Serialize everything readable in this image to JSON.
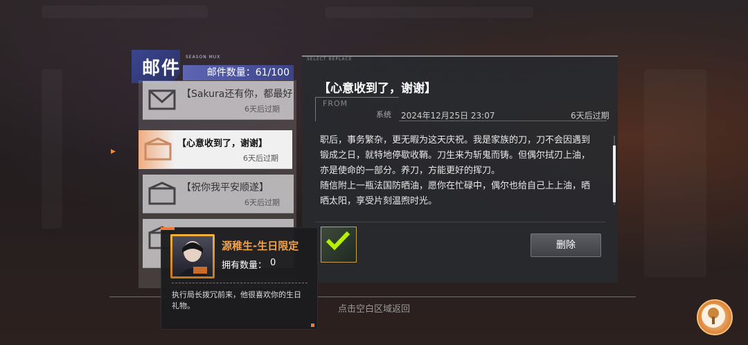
{
  "mail_panel": {
    "title": "邮件",
    "subtitle": "SEASON MUX",
    "count_label": "邮件数量：61/100"
  },
  "mail_list": [
    {
      "title": "【Sakura还有你，都最好",
      "expire": "6天后过期",
      "selected": false
    },
    {
      "title": "【心意收到了，谢谢】",
      "expire": "6天后过期",
      "selected": true
    },
    {
      "title": "【祝你我平安顺遂】",
      "expire": "6天后过期",
      "selected": false
    }
  ],
  "detail": {
    "tag": "SELECT REPLACE",
    "title": "【心意收到了，谢谢】",
    "from_label": "FROM",
    "sender": "系统",
    "date": "2024年12月25日 23:07",
    "expire": "6天后过期",
    "body_lines": [
      "职后，事务繁杂，更无暇为这天庆祝。我是家族的刀，刀不会因遇到",
      "锻成之日，就特地停歇收鞘。刀生来为斩鬼而铸。但偶尔拭刃上油，",
      "亦是使命的一部分。养刀，方能更好的挥刀。",
      "随信附上一瓶法国防晒油，愿你在忙碌中，偶尔也给自己上上油，晒",
      "晒太阳，享受片刻温煦时光。"
    ],
    "delete_label": "删除"
  },
  "tooltip": {
    "item_name": "源稚生-生日限定",
    "qty_label": "拥有数量：",
    "qty_value": "0",
    "description": "执行局长拨冗前来，他很喜欢你的生日礼物。"
  },
  "return_hint": "点击空白区域返回",
  "colors": {
    "accent_orange": "#ee7a3a",
    "count_bar_blue": "#5e66b4",
    "item_name_orange": "#f2a24a"
  }
}
